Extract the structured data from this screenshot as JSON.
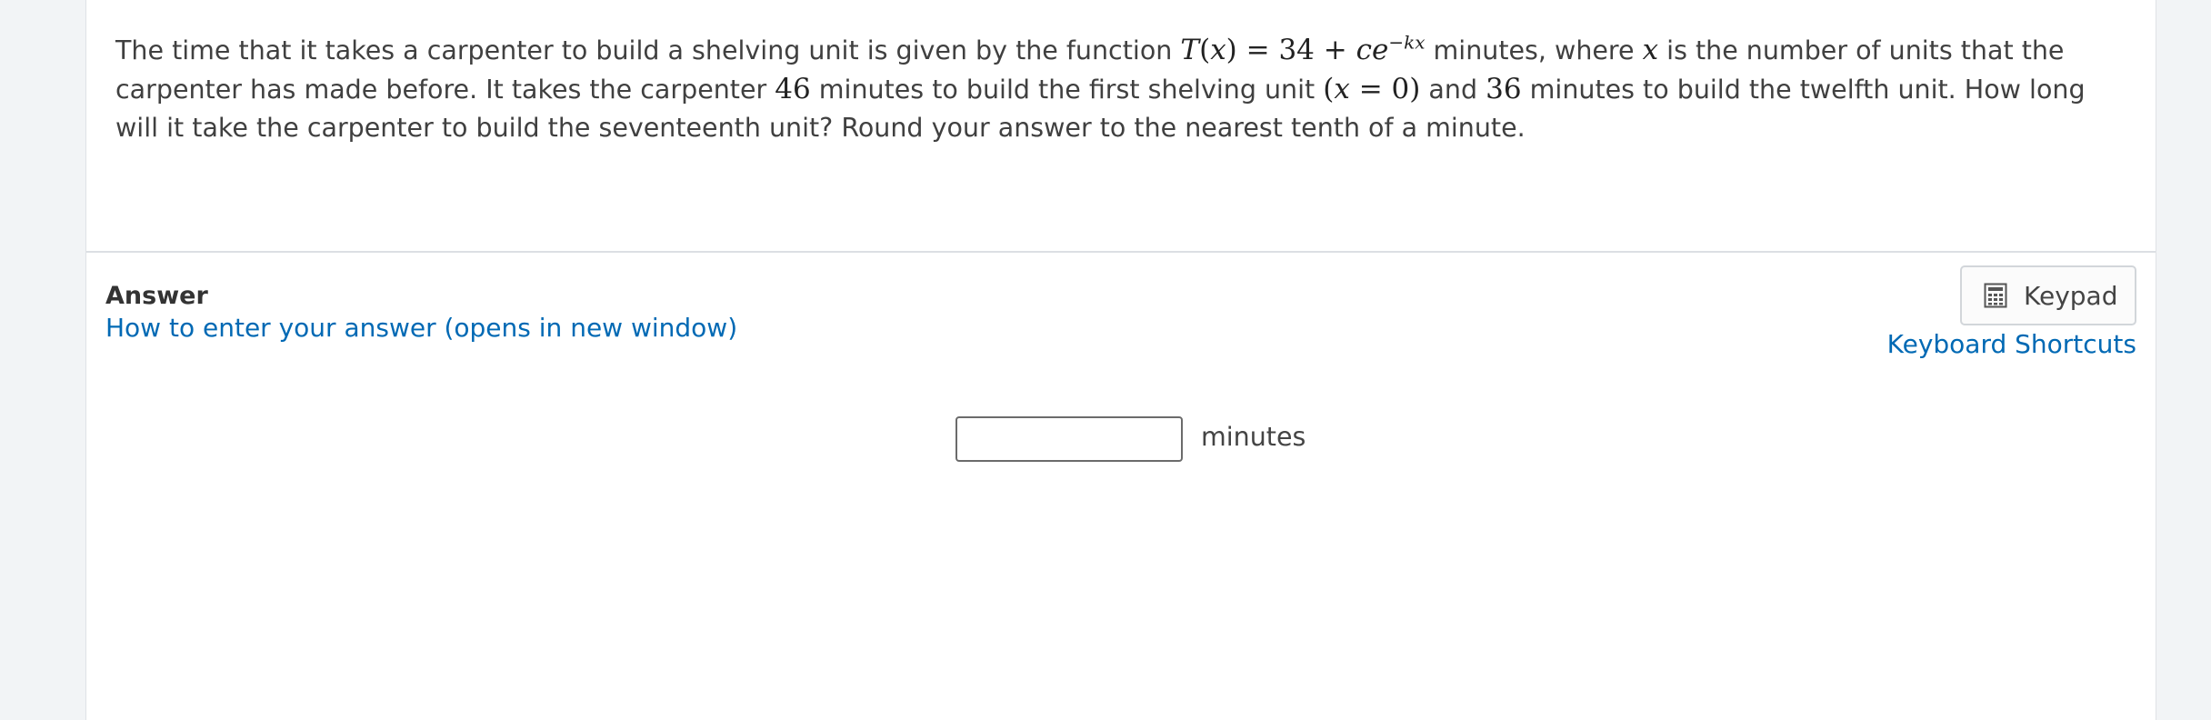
{
  "question": {
    "p1": "The time that it takes a carpenter to build a shelving unit is given by the function ",
    "f_T": "T",
    "f_x": "x",
    "f_const": "34",
    "f_c": "ce",
    "f_exp": "−kx",
    "p2": " minutes, where ",
    "var_x": "x",
    "p3": " is the number of units that the carpenter has made before.  It takes the carpenter ",
    "first_minutes": "46",
    "p4": " minutes to build the first shelving unit ",
    "cond_x": "x",
    "cond_val": "0",
    "p5": " and ",
    "twelfth_minutes": "36",
    "p6": " minutes to build the twelfth unit.  How long will it take the carpenter to build the seventeenth unit?  Round your answer to the nearest tenth of a minute."
  },
  "answer": {
    "label": "Answer",
    "help_link": "How to enter your answer (opens in new window)",
    "keypad_label": "Keypad",
    "keypad_icon": "calculator-icon",
    "shortcuts_link": "Keyboard Shortcuts",
    "input_value": "",
    "unit": "minutes"
  },
  "colors": {
    "link": "#0069b4",
    "background": "#f2f4f6",
    "card": "#ffffff"
  }
}
